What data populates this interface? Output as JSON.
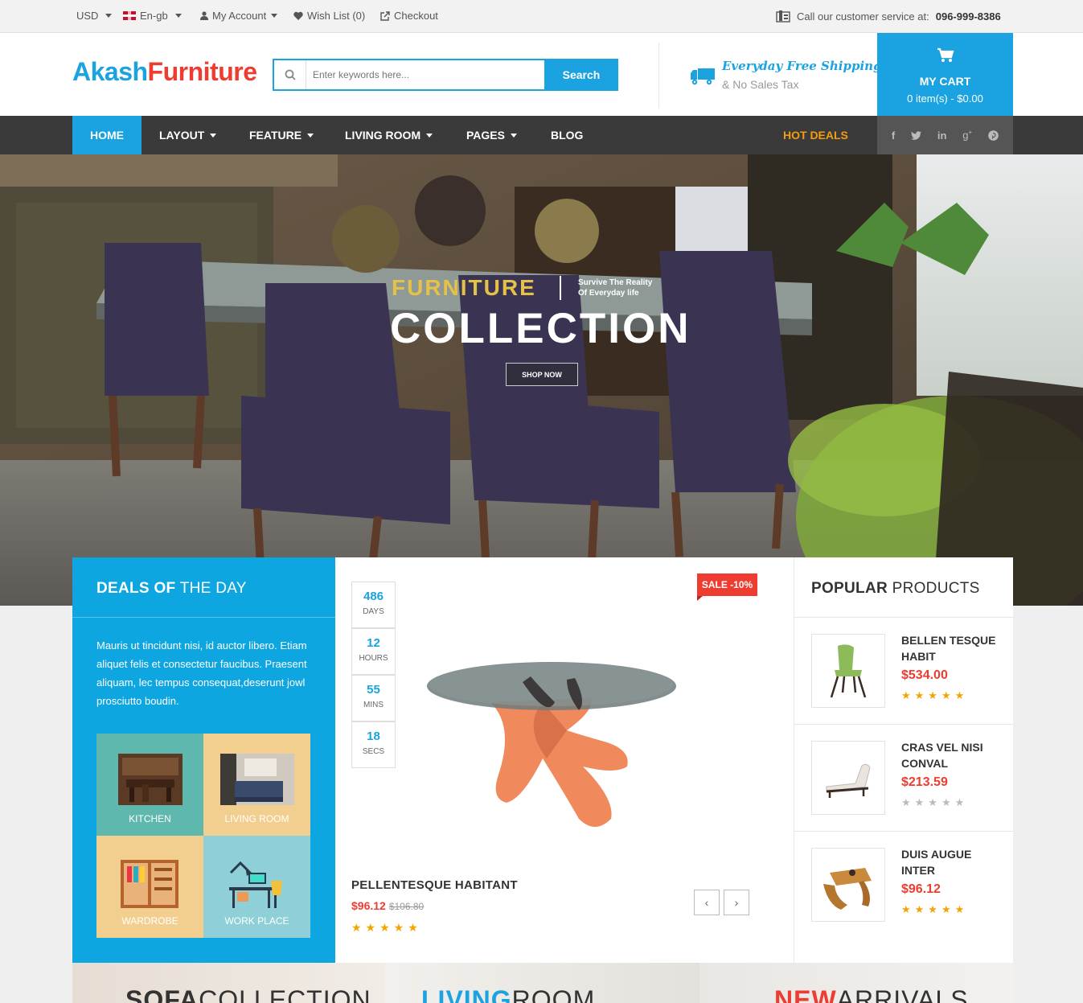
{
  "topbar": {
    "currency": "USD",
    "language": "En-gb",
    "account": "My Account",
    "wishlist": "Wish List (0)",
    "checkout": "Checkout",
    "call_label": "Call our customer service at:",
    "phone": "096-999-8386"
  },
  "header": {
    "logo_part1": "Akash",
    "logo_part2": "Furniture",
    "search_placeholder": "Enter keywords here...",
    "search_button": "Search",
    "shipping_title": "Everyday Free Shipping",
    "shipping_sub": "& No Sales Tax",
    "cart_title": "MY CART",
    "cart_summary": "0 item(s) - $0.00"
  },
  "nav": {
    "items": [
      "HOME",
      "LAYOUT",
      "FEATURE",
      "LIVING ROOM",
      "PAGES",
      "BLOG"
    ],
    "hot_deals": "HOT DEALS"
  },
  "hero": {
    "word1": "FURNITURE",
    "tag1": "Survive The Reality",
    "tag2": "Of Everyday life",
    "title": "COLLECTION",
    "cta": "SHOP NOW"
  },
  "deals": {
    "title_bold": "DEALS OF",
    "title_light": "THE DAY",
    "description": "Mauris ut tincidunt nisi, id auctor libero. Etiam aliquet felis et consectetur faucibus. Praesent aliquam, lec tempus consequat,deserunt jowl prosciutto boudin.",
    "tiles": [
      "KITCHEN",
      "LIVING ROOM",
      "WARDROBE",
      "WORK PLACE"
    ]
  },
  "featured": {
    "countdown": [
      {
        "value": "486",
        "unit": "DAYS"
      },
      {
        "value": "12",
        "unit": "HOURS"
      },
      {
        "value": "55",
        "unit": "MINS"
      },
      {
        "value": "18",
        "unit": "SECS"
      }
    ],
    "sale_badge": "SALE -10%",
    "name": "PELLENTESQUE HABITANT",
    "price": "$96.12",
    "old_price": "$106.80",
    "rating": 5
  },
  "popular": {
    "title_bold": "POPULAR",
    "title_light": "PRODUCTS",
    "items": [
      {
        "name": "BELLEN TESQUE HABIT",
        "price": "$534.00",
        "rating": 5
      },
      {
        "name": "CRAS VEL NISI CONVAL",
        "price": "$213.59",
        "rating": 0
      },
      {
        "name": "DUIS AUGUE INTER",
        "price": "$96.12",
        "rating": 5
      }
    ]
  },
  "banners": [
    {
      "bold": "SOFA",
      "light": "COLLECTION"
    },
    {
      "bold": "LIVING",
      "light": "ROOM"
    },
    {
      "bold": "NEW",
      "light": "ARRIVALS"
    }
  ],
  "colors": {
    "accent": "#1aa3e0",
    "sale": "#ee3c30",
    "nav": "#3a3a3a",
    "hot_deals": "#f39c12"
  }
}
